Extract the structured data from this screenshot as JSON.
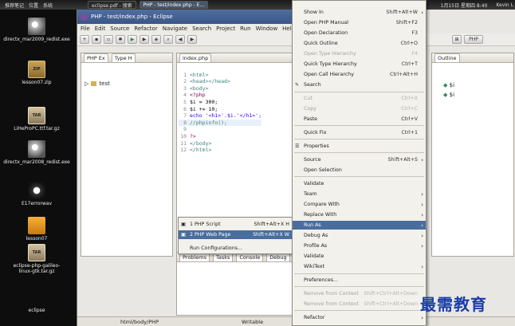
{
  "taskbar": {
    "items": [
      "推荐笔记",
      "位置",
      "系统"
    ],
    "tasks": [
      "eclipse.pdf - 搜索",
      "PHP - test/index.php - E..."
    ],
    "clock": "Kevin L",
    "date": "1月15日 星期四 8:40"
  },
  "desktop": {
    "icons": [
      {
        "label": "directx_mar2009_redist.exe",
        "icon": "disc-icon"
      },
      {
        "label": "lesson07.zip",
        "icon": "zip-icon"
      },
      {
        "label": "LiHeProPC.ttf.tar.gz",
        "icon": "tar-icon"
      },
      {
        "label": "directx_mar2008_redist.exe",
        "icon": "disc-icon"
      },
      {
        "label": "E17errorwav",
        "icon": "audio-icon"
      },
      {
        "label": "lesson07",
        "icon": "folder-icon"
      },
      {
        "label": "eclipse-php-galileo-linux-gtk.tar.gz",
        "icon": "tar-icon"
      },
      {
        "label": "eclipse",
        "icon": "folder-icon"
      }
    ]
  },
  "window": {
    "title": "PHP - test/index.php - Eclipse",
    "menu": [
      "File",
      "Edit",
      "Source",
      "Refactor",
      "Navigate",
      "Search",
      "Project",
      "Run",
      "Window",
      "Help"
    ]
  },
  "explorer": {
    "tabs": [
      "PHP Ex",
      "Type H"
    ],
    "tree": [
      "test"
    ]
  },
  "editor": {
    "tab": "index.php",
    "lines": [
      {
        "n": "1",
        "text": "<html>"
      },
      {
        "n": "2",
        "text": "<head></head>"
      },
      {
        "n": "3",
        "text": "<body>"
      },
      {
        "n": "4",
        "text": "<?php"
      },
      {
        "n": "5",
        "text": "$i = 300;"
      },
      {
        "n": "6",
        "text": "$i += 10;"
      },
      {
        "n": "7",
        "text": "echo '<h1>'.$i.'</h1>';"
      },
      {
        "n": "8",
        "text": "//phpinfo();"
      },
      {
        "n": "9",
        "text": ""
      },
      {
        "n": "10",
        "text": "?>"
      },
      {
        "n": "11",
        "text": "</body>"
      },
      {
        "n": "12",
        "text": "</html>"
      }
    ]
  },
  "outline": {
    "tab": "Outline",
    "items": [
      "$i",
      "$i"
    ],
    "perspective": "PHP"
  },
  "bottom": {
    "tabs": [
      "Problems",
      "Tasks",
      "Console",
      "Debug"
    ]
  },
  "status": {
    "path": "html/body/PHP",
    "mode": "Writable"
  },
  "context_menu": {
    "items": [
      {
        "label": "Show In",
        "shortcut": "Shift+Alt+W",
        "arrow": true
      },
      {
        "label": "Open PHP Manual",
        "shortcut": "Shift+F2"
      },
      {
        "label": "Open Declaration",
        "shortcut": "F3"
      },
      {
        "label": "Quick Outline",
        "shortcut": "Ctrl+O"
      },
      {
        "label": "Open Type Hierarchy",
        "shortcut": "F4",
        "disabled": true
      },
      {
        "label": "Quick Type Hierarchy",
        "shortcut": "Ctrl+T"
      },
      {
        "label": "Open Call Hierarchy",
        "shortcut": "Ctrl+Alt+H"
      },
      {
        "label": "Search",
        "shortcut": "",
        "icon": "search-icon"
      },
      {
        "label": "Cut",
        "shortcut": "Ctrl+X",
        "disabled": true
      },
      {
        "label": "Copy",
        "shortcut": "Ctrl+C",
        "disabled": true
      },
      {
        "label": "Paste",
        "shortcut": "Ctrl+V"
      },
      {
        "label": "Quick Fix",
        "shortcut": "Ctrl+1"
      },
      {
        "label": "Properties",
        "shortcut": "",
        "icon": "properties-icon"
      },
      {
        "label": "Source",
        "shortcut": "Shift+Alt+S",
        "arrow": true
      },
      {
        "label": "Open Selection",
        "shortcut": ""
      },
      {
        "label": "Validate",
        "shortcut": ""
      },
      {
        "label": "Team",
        "shortcut": "",
        "arrow": true
      },
      {
        "label": "Compare With",
        "shortcut": "",
        "arrow": true
      },
      {
        "label": "Replace With",
        "shortcut": "",
        "arrow": true
      },
      {
        "label": "Run As",
        "shortcut": "",
        "arrow": true,
        "selected": true
      },
      {
        "label": "Debug As",
        "shortcut": "",
        "arrow": true
      },
      {
        "label": "Profile As",
        "shortcut": "",
        "arrow": true
      },
      {
        "label": "Validate",
        "shortcut": ""
      },
      {
        "label": "WikiText",
        "shortcut": "",
        "arrow": true
      },
      {
        "label": "Preferences...",
        "shortcut": ""
      },
      {
        "label": "Remove from Context",
        "shortcut": "Shift+Ctrl+Alt+Down",
        "disabled": true
      },
      {
        "label": "Remove from Context",
        "shortcut": "Shift+Ctrl+Alt+Down",
        "disabled": true
      },
      {
        "label": "Refactor",
        "shortcut": "",
        "arrow": true
      }
    ]
  },
  "submenu": {
    "items": [
      {
        "label": "1 PHP Script",
        "shortcut": "Shift+Alt+X H"
      },
      {
        "label": "2 PHP Web Page",
        "shortcut": "Shift+Alt+X W",
        "selected": true
      },
      {
        "label": "Run Configurations...",
        "shortcut": ""
      }
    ]
  },
  "watermark": "最需教育",
  "colors": {
    "selection": "#496e9e",
    "titlebar": "#3a5685",
    "watermark": "#1a3ea8"
  }
}
